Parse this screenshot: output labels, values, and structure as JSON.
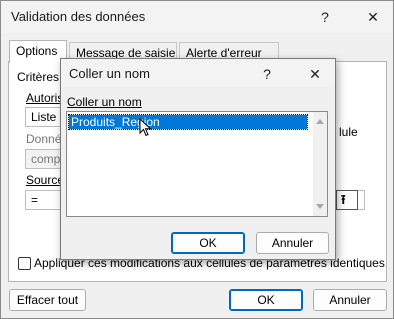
{
  "outer": {
    "title": "Validation des données",
    "help_icon": "?",
    "close_icon": "✕",
    "tabs": [
      "Options",
      "Message de saisie",
      "Alerte d'erreur"
    ],
    "criteria_label": "Critères d",
    "allow_label": "Autoris",
    "allow_value": "Liste",
    "data_label": "Donné",
    "data_value": "compr",
    "source_label": "Source",
    "source_value": "=",
    "side_text": "lule",
    "apply_checkbox_label": "Appliquer ces modifications aux cellules de paramètres identiques",
    "apply_checked": false,
    "clear_all_label": "Effacer tout",
    "ok_label": "OK",
    "cancel_label": "Annuler"
  },
  "inner": {
    "title": "Coller un nom",
    "help_icon": "?",
    "close_icon": "✕",
    "list_label": "Coller un nom",
    "names": [
      "Produits_Region"
    ],
    "ok_label": "OK",
    "cancel_label": "Annuler"
  }
}
